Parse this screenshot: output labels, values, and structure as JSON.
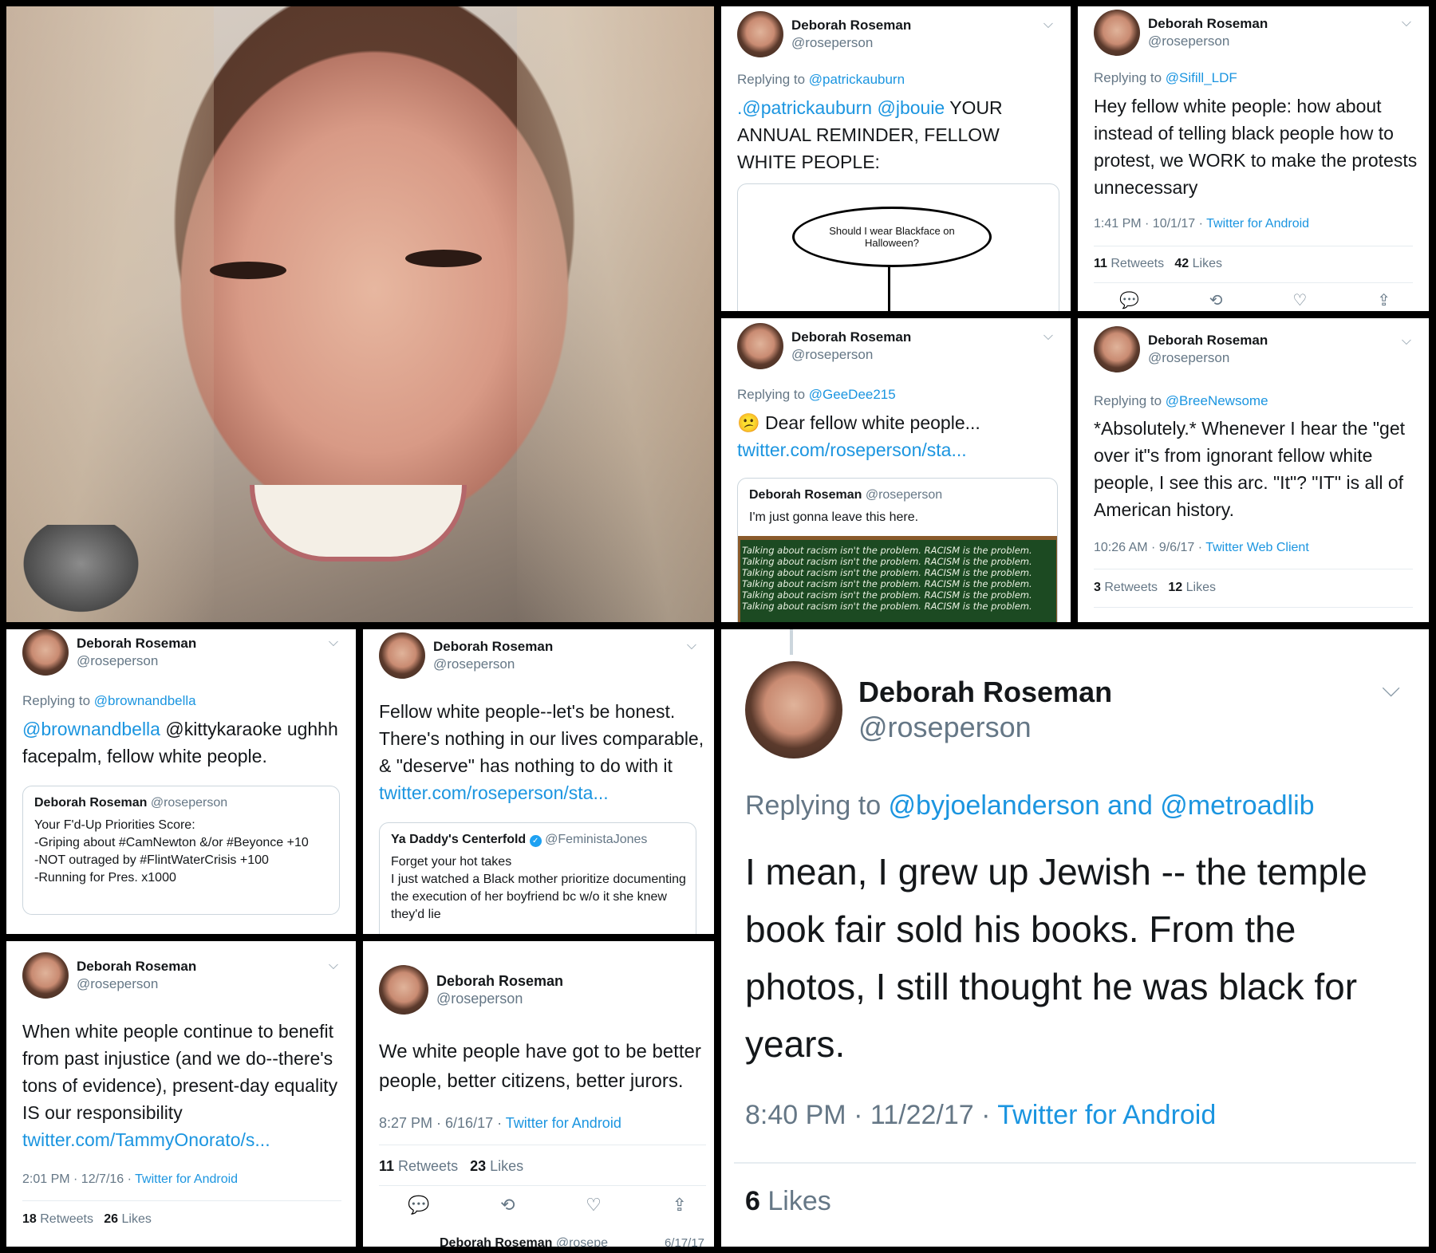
{
  "p1": {
    "name": "Deborah Roseman",
    "handle": "@roseperson",
    "reply_prefix": "Replying to ",
    "reply_to": "@patrickauburn",
    "body_link": ".@patrickauburn @jbouie",
    "body_text": " YOUR ANNUAL REMINDER, FELLOW WHITE PEOPLE:",
    "flow_text": "Should I wear Blackface on Halloween?"
  },
  "p2": {
    "name": "Deborah Roseman",
    "handle": "@roseperson",
    "reply_prefix": "Replying to ",
    "reply_to": "@Sifill_LDF",
    "body": "Hey fellow white people: how about instead of telling black people how to protest, we WORK to make the protests unnecessary",
    "time": "1:41 PM · 10/1/17 · ",
    "client": "Twitter for Android",
    "retweets": "11",
    "retweets_label": " Retweets",
    "likes": "42",
    "likes_label": " Likes"
  },
  "p3": {
    "name": "Deborah Roseman",
    "handle": "@roseperson",
    "reply_prefix": "Replying to ",
    "reply_to": "@GeeDee215",
    "body": "😕 Dear fellow white people...",
    "body_link": "twitter.com/roseperson/sta...",
    "q_name": "Deborah Roseman",
    "q_handle": "@roseperson",
    "q_text": "I'm just gonna leave this here.",
    "chalk_line": "Talking about racism isn't the problem. RACISM is the problem."
  },
  "p4": {
    "name": "Deborah Roseman",
    "handle": "@roseperson",
    "reply_prefix": "Replying to ",
    "reply_to": "@BreeNewsome",
    "body": "*Absolutely.* Whenever I hear the \"get over it\"s from ignorant fellow white people, I see this arc. \"It\"? \"IT\" is all of American history.",
    "time": "10:26 AM · 9/6/17 · ",
    "client": "Twitter Web Client",
    "retweets": "3",
    "retweets_label": " Retweets",
    "likes": "12",
    "likes_label": " Likes"
  },
  "p5": {
    "name": "Deborah Roseman",
    "handle": "@roseperson",
    "reply_prefix": "Replying to ",
    "reply_to": "@brownandbella",
    "body_link": "@brownandbella",
    "body_text": " @kittykaraoke ughhh facepalm, fellow white people.",
    "q_name": "Deborah Roseman",
    "q_handle": "@roseperson",
    "q_lines": [
      "Your F'd-Up Priorities Score:",
      "-Griping about #CamNewton &/or #Beyonce +10",
      "-NOT outraged by #FlintWaterCrisis +100",
      "-Running for Pres. x1000"
    ]
  },
  "p6": {
    "name": "Deborah Roseman",
    "handle": "@roseperson",
    "body": "Fellow white people--let's be honest. There's nothing in our lives comparable, & \"deserve\" has nothing to do with it",
    "body_link": "twitter.com/roseperson/sta...",
    "q_name": "Ya Daddy's Centerfold",
    "q_handle": "@FeministaJones",
    "q_lines": [
      "Forget your hot takes",
      "I just watched a Black mother prioritize documenting the execution of her boyfriend bc w/o it she knew they'd lie"
    ]
  },
  "p7": {
    "name": "Deborah Roseman",
    "handle": "@roseperson",
    "body": "When white people continue to benefit from past injustice (and we do--there's tons of evidence), present-day equality IS our responsibility ",
    "body_link": "twitter.com/TammyOnorato/s...",
    "time": "2:01 PM · 12/7/16 · ",
    "client": "Twitter for Android",
    "retweets": "18",
    "retweets_label": " Retweets",
    "likes": "26",
    "likes_label": " Likes"
  },
  "p8": {
    "name": "Deborah Roseman",
    "handle": "@roseperson",
    "body": "We white people have got to be better people, better citizens, better jurors.",
    "time": "8:27 PM · 6/16/17 · ",
    "client": "Twitter for Android",
    "retweets": "11",
    "retweets_label": " Retweets",
    "likes": "23",
    "likes_label": " Likes",
    "next_name": "Deborah Roseman",
    "next_handle": "@rosepe",
    "next_date": "6/17/17"
  },
  "p9": {
    "name": "Deborah Roseman",
    "handle": "@roseperson",
    "reply_prefix": "Replying to ",
    "reply_to": "@byjoelanderson and @metroadlib",
    "body": "I mean, I grew up Jewish -- the temple book fair sold his books. From the photos, I still thought he was black for years.",
    "time": "8:40 PM · 11/22/17 · ",
    "client": "Twitter for Android",
    "likes": "6",
    "likes_label": " Likes"
  },
  "icons": {
    "reply": "reply-icon",
    "retweet": "retweet-icon",
    "like": "heart-icon",
    "share": "share-icon",
    "chevron": "chevron-down-icon"
  }
}
